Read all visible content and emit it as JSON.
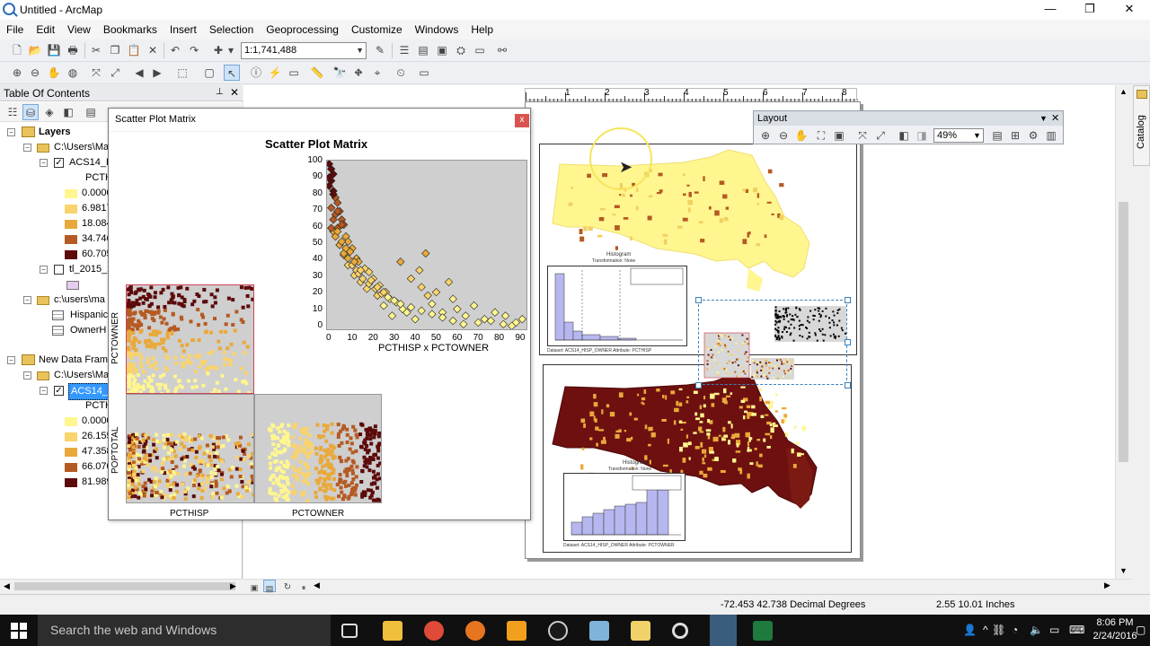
{
  "window": {
    "title": "Untitled - ArcMap",
    "minimize": "—",
    "maximize": "❐",
    "close": "✕"
  },
  "menu": [
    "File",
    "Edit",
    "View",
    "Bookmarks",
    "Insert",
    "Selection",
    "Geoprocessing",
    "Customize",
    "Windows",
    "Help"
  ],
  "toolbar": {
    "scale": "1:1,741,488"
  },
  "toc": {
    "title": "Table Of Contents",
    "pin": "📌",
    "close": "✕",
    "rows": [
      {
        "label": "Layers",
        "bold": true
      },
      {
        "label": "C:\\Users\\Ma"
      },
      {
        "label": "ACS14_H"
      },
      {
        "label": "PCTH"
      },
      {
        "label": "0.0000"
      },
      {
        "label": "6.9817"
      },
      {
        "label": "18.084"
      },
      {
        "label": "34.746"
      },
      {
        "label": "60.705"
      },
      {
        "label": "tl_2015_2"
      },
      {
        "label": ""
      },
      {
        "label": "c:\\users\\ma"
      },
      {
        "label": "Hispanic"
      },
      {
        "label": "OwnerH"
      },
      {
        "label": "New Data Fram"
      },
      {
        "label": "C:\\Users\\Ma"
      },
      {
        "label": "ACS14_H"
      },
      {
        "label": "PCTH"
      },
      {
        "label": "0.0000"
      },
      {
        "label": "26.155"
      },
      {
        "label": "47.358"
      },
      {
        "label": "66.070"
      },
      {
        "label": "81.989"
      }
    ],
    "colors": {
      "c1": "#fff68f",
      "c2": "#f9d36b",
      "c3": "#e9a93a",
      "c4": "#b55a22",
      "c5": "#5c0a0a",
      "poly": "#e6ccf0"
    }
  },
  "layout_toolbar": {
    "title": "Layout",
    "zoom": "49%"
  },
  "ruler": {
    "ticks": [
      "1",
      "2",
      "3",
      "4",
      "5",
      "6",
      "7",
      "8"
    ]
  },
  "catalog": {
    "label": "Catalog"
  },
  "scatter_dialog": {
    "title": "Scatter Plot Matrix",
    "close": "x",
    "heading": "Scatter Plot Matrix",
    "main_plot_caption": "PCTHISP x PCTOWNER",
    "row_labels": [
      "PCTOWNER",
      "POPTOTAL"
    ],
    "col_labels": [
      "PCTHISP",
      "PCTOWNER"
    ],
    "y_ticks": [
      "100",
      "90",
      "80",
      "70",
      "60",
      "50",
      "40",
      "30",
      "20",
      "10",
      "0"
    ],
    "x_ticks": [
      "0",
      "10",
      "20",
      "30",
      "40",
      "50",
      "60",
      "70",
      "80",
      "90"
    ]
  },
  "chart_data": {
    "type": "scatter",
    "title": "Scatter Plot Matrix",
    "xlabel": "PCTHISP x PCTOWNER",
    "xlim": [
      0,
      95
    ],
    "ylim": [
      0,
      100
    ],
    "x": [
      1,
      2,
      3,
      2,
      1,
      3,
      4,
      5,
      2,
      6,
      4,
      7,
      8,
      5,
      3,
      9,
      10,
      6,
      12,
      11,
      8,
      14,
      15,
      10,
      18,
      20,
      13,
      22,
      16,
      25,
      19,
      28,
      24,
      30,
      33,
      27,
      36,
      38,
      31,
      42,
      40,
      45,
      35,
      48,
      50,
      44,
      55,
      52,
      58,
      47,
      60,
      62,
      66,
      70,
      75,
      80,
      85,
      90,
      93,
      2,
      4,
      6,
      8,
      10,
      12,
      14,
      3,
      5,
      7,
      9,
      15,
      17,
      20,
      23,
      26,
      29,
      32,
      35,
      40,
      45,
      50,
      55,
      60,
      65,
      72,
      78,
      84,
      88,
      1,
      3,
      5,
      7,
      11,
      13,
      16,
      21,
      24,
      27
    ],
    "y": [
      98,
      95,
      92,
      88,
      85,
      82,
      78,
      75,
      72,
      70,
      68,
      65,
      62,
      60,
      58,
      55,
      52,
      50,
      48,
      46,
      44,
      42,
      40,
      38,
      36,
      34,
      32,
      30,
      28,
      26,
      24,
      22,
      20,
      18,
      16,
      14,
      12,
      10,
      8,
      6,
      30,
      25,
      40,
      20,
      15,
      35,
      10,
      22,
      28,
      45,
      18,
      12,
      8,
      14,
      6,
      10,
      8,
      4,
      6,
      60,
      55,
      50,
      45,
      42,
      38,
      35,
      65,
      58,
      52,
      48,
      33,
      30,
      27,
      24,
      21,
      19,
      17,
      15,
      13,
      11,
      9,
      7,
      5,
      3,
      4,
      5,
      3,
      2,
      90,
      80,
      70,
      62,
      46,
      40,
      35,
      29,
      25,
      22
    ],
    "series": [
      {
        "values_note": ""
      }
    ]
  },
  "layout_elements": {
    "hist1_title": "Histogram",
    "hist1_sub": "Transformation: None",
    "hist1_dataset": "Dataset: ACS14_HISP_OWNER Attribute: PCTHISP",
    "hist2_title": "Histogram",
    "hist2_sub": "Transformation: None",
    "hist2_dataset": "Dataset: ACS14_HISP_OWNER Attribute: PCTOWNER"
  },
  "status": {
    "coords": "-72.453  42.738 Decimal Degrees",
    "page_pos": "2.55  10.01 Inches"
  },
  "taskbar": {
    "search": "Search the web and Windows",
    "time": "8:06 PM",
    "date": "2/24/2016"
  }
}
